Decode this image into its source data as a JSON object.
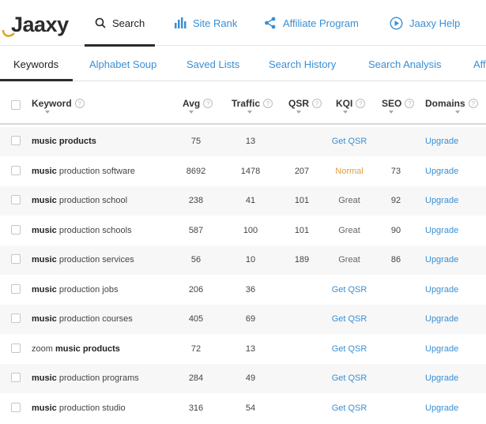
{
  "brand": {
    "logo_text": "Jaaxy"
  },
  "topnav": {
    "items": [
      {
        "label": "Search",
        "icon": "search-icon",
        "active": true
      },
      {
        "label": "Site Rank",
        "icon": "bar-chart-icon",
        "active": false
      },
      {
        "label": "Affiliate Program",
        "icon": "share-icon",
        "active": false
      },
      {
        "label": "Jaaxy Help",
        "icon": "play-circle-icon",
        "active": false
      }
    ]
  },
  "subtabs": {
    "items": [
      {
        "label": "Keywords",
        "active": true
      },
      {
        "label": "Alphabet Soup",
        "active": false
      },
      {
        "label": "Saved Lists",
        "active": false
      },
      {
        "label": "Search History",
        "active": false
      },
      {
        "label": "Search Analysis",
        "active": false
      },
      {
        "label": "Aff",
        "active": false
      }
    ]
  },
  "table": {
    "columns": [
      "Keyword",
      "Avg",
      "Traffic",
      "QSR",
      "KQI",
      "SEO",
      "Domains"
    ],
    "rows": [
      {
        "kw_pre": "",
        "kw_bold": "music products",
        "kw_post": "",
        "avg": "75",
        "traffic": "13",
        "qsr": "",
        "kqi": "Get QSR",
        "kqi_type": "link",
        "seo": "",
        "domains": "Upgrade"
      },
      {
        "kw_pre": "",
        "kw_bold": "music",
        "kw_post": " production software",
        "avg": "8692",
        "traffic": "1478",
        "qsr": "207",
        "kqi": "Normal",
        "kqi_type": "normal",
        "seo": "73",
        "domains": "Upgrade"
      },
      {
        "kw_pre": "",
        "kw_bold": "music",
        "kw_post": " production school",
        "avg": "238",
        "traffic": "41",
        "qsr": "101",
        "kqi": "Great",
        "kqi_type": "great",
        "seo": "92",
        "domains": "Upgrade"
      },
      {
        "kw_pre": "",
        "kw_bold": "music",
        "kw_post": " production schools",
        "avg": "587",
        "traffic": "100",
        "qsr": "101",
        "kqi": "Great",
        "kqi_type": "great",
        "seo": "90",
        "domains": "Upgrade"
      },
      {
        "kw_pre": "",
        "kw_bold": "music",
        "kw_post": " production services",
        "avg": "56",
        "traffic": "10",
        "qsr": "189",
        "kqi": "Great",
        "kqi_type": "great",
        "seo": "86",
        "domains": "Upgrade"
      },
      {
        "kw_pre": "",
        "kw_bold": "music",
        "kw_post": " production jobs",
        "avg": "206",
        "traffic": "36",
        "qsr": "",
        "kqi": "Get QSR",
        "kqi_type": "link",
        "seo": "",
        "domains": "Upgrade"
      },
      {
        "kw_pre": "",
        "kw_bold": "music",
        "kw_post": " production courses",
        "avg": "405",
        "traffic": "69",
        "qsr": "",
        "kqi": "Get QSR",
        "kqi_type": "link",
        "seo": "",
        "domains": "Upgrade"
      },
      {
        "kw_pre": "zoom ",
        "kw_bold": "music products",
        "kw_post": "",
        "avg": "72",
        "traffic": "13",
        "qsr": "",
        "kqi": "Get QSR",
        "kqi_type": "link",
        "seo": "",
        "domains": "Upgrade"
      },
      {
        "kw_pre": "",
        "kw_bold": "music",
        "kw_post": " production programs",
        "avg": "284",
        "traffic": "49",
        "qsr": "",
        "kqi": "Get QSR",
        "kqi_type": "link",
        "seo": "",
        "domains": "Upgrade"
      },
      {
        "kw_pre": "",
        "kw_bold": "music",
        "kw_post": " production studio",
        "avg": "316",
        "traffic": "54",
        "qsr": "",
        "kqi": "Get QSR",
        "kqi_type": "link",
        "seo": "",
        "domains": "Upgrade"
      }
    ]
  },
  "colors": {
    "link": "#3a8fd4",
    "kqi_normal": "#e0a040",
    "row_alt": "#f7f7f7"
  }
}
